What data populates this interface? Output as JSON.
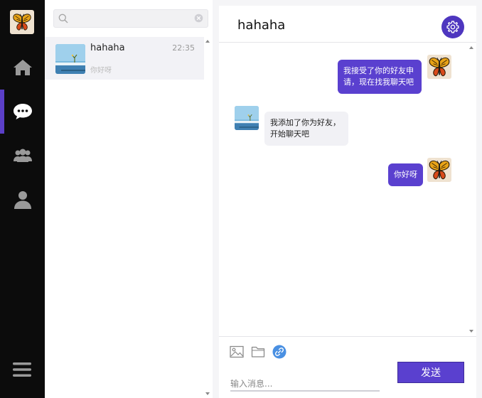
{
  "sidebar": {
    "items": [
      {
        "name": "home",
        "icon": "home-icon"
      },
      {
        "name": "chat",
        "icon": "chat-icon",
        "active": true
      },
      {
        "name": "groups",
        "icon": "groups-icon"
      },
      {
        "name": "profile",
        "icon": "user-icon"
      }
    ],
    "menu_icon": "hamburger-menu-icon",
    "accent": "#5b3fc8"
  },
  "search": {
    "placeholder": "",
    "value": ""
  },
  "conversations": [
    {
      "name": "hahaha",
      "time": "22:35",
      "last_message": "你好呀",
      "selected": true
    }
  ],
  "chat": {
    "title": "hahaha",
    "settings_icon": "gear-icon",
    "messages": [
      {
        "direction": "out",
        "text": "我接受了你的好友申请，现在找我聊天吧"
      },
      {
        "direction": "in",
        "text": "我添加了你为好友，开始聊天吧"
      },
      {
        "direction": "out",
        "text": "你好呀"
      }
    ]
  },
  "composer": {
    "tools": [
      "image-icon",
      "folder-icon",
      "link-icon"
    ],
    "placeholder": "输入消息...",
    "send_label": "发送"
  },
  "colors": {
    "accent": "#5a40cf",
    "nav_bg": "#0c0c0c",
    "incoming_bubble": "#f1f1f5"
  }
}
